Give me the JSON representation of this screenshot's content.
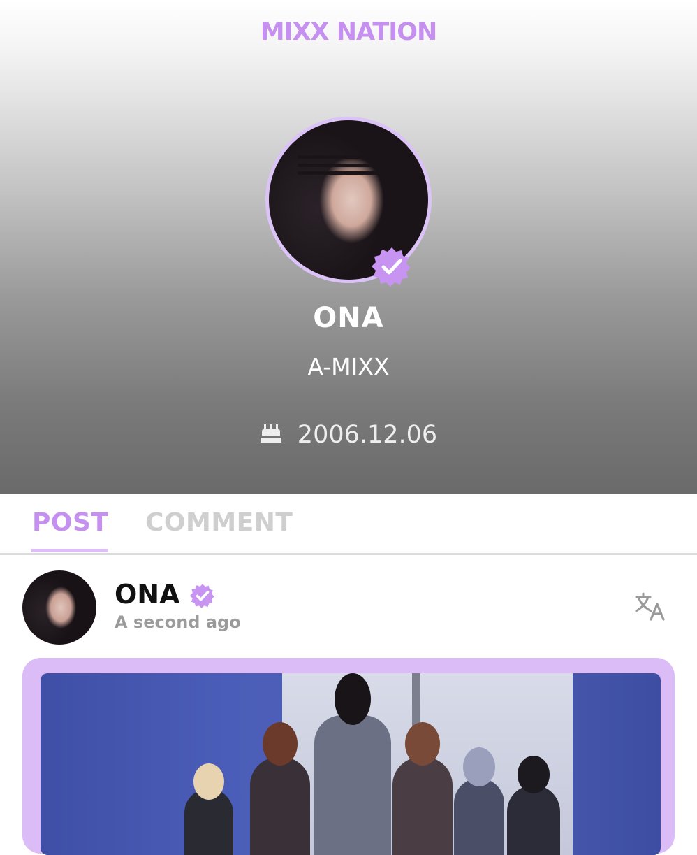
{
  "app": {
    "title": "MIXX NATION"
  },
  "profile": {
    "name": "ONA",
    "group": "A-MIXX",
    "birthday": "2006.12.06",
    "verified": true
  },
  "tabs": [
    {
      "label": "POST",
      "active": true
    },
    {
      "label": "COMMENT",
      "active": false
    }
  ],
  "post": {
    "author": "ONA",
    "time": "A second ago",
    "verified": true
  },
  "colors": {
    "accent": "#c590f0",
    "accent_light": "#dcbcf6",
    "tab_inactive": "#cfcfcf",
    "time_gray": "#9b9b9b"
  },
  "icons": {
    "verified": "verified-badge-icon",
    "birthday": "cake-icon",
    "translate": "translate-icon"
  }
}
